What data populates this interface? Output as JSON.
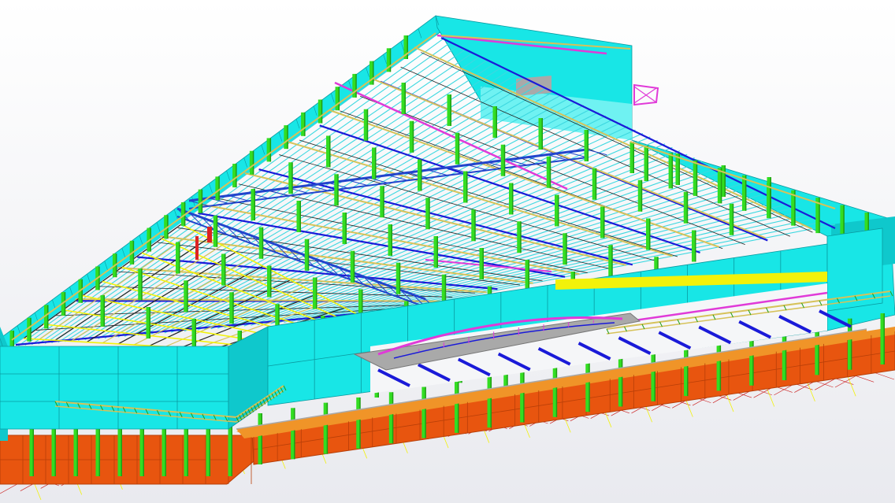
{
  "viewport": {
    "background_top": "#ffffff",
    "background_bottom": "#e9eaef"
  },
  "colors": {
    "facade": "#18e6e6",
    "facade_dark": "#0fc8cc",
    "facade_light": "#6ff2f2",
    "foundation": "#e8550f",
    "foundation_dark": "#b83f08",
    "foundation_top": "#f09428",
    "column": "#33dd22",
    "column_dark": "#1f9e14",
    "primary_beam": "#1a1ad8",
    "purlin": "#3dd8e0",
    "truss": "#2244cc",
    "secondary_beam": "#d6c25a",
    "bracing": "#e03ad8",
    "joist": "#222222",
    "steel_grey": "#a9a9a9",
    "yellow_member": "#f2f20a",
    "red_member": "#dd2222",
    "ground_line": "#cc2222",
    "wall_lines": "#0a9aa0"
  },
  "model": {
    "view": "isometric",
    "elements": [
      "concrete-foundation-wall",
      "cyan-facade-panels",
      "steel-columns",
      "roof-purlins",
      "primary-girders",
      "roof-trusses",
      "secondary-beams",
      "diagonal-bracing",
      "canopy-slab",
      "ground-load-lines"
    ]
  }
}
